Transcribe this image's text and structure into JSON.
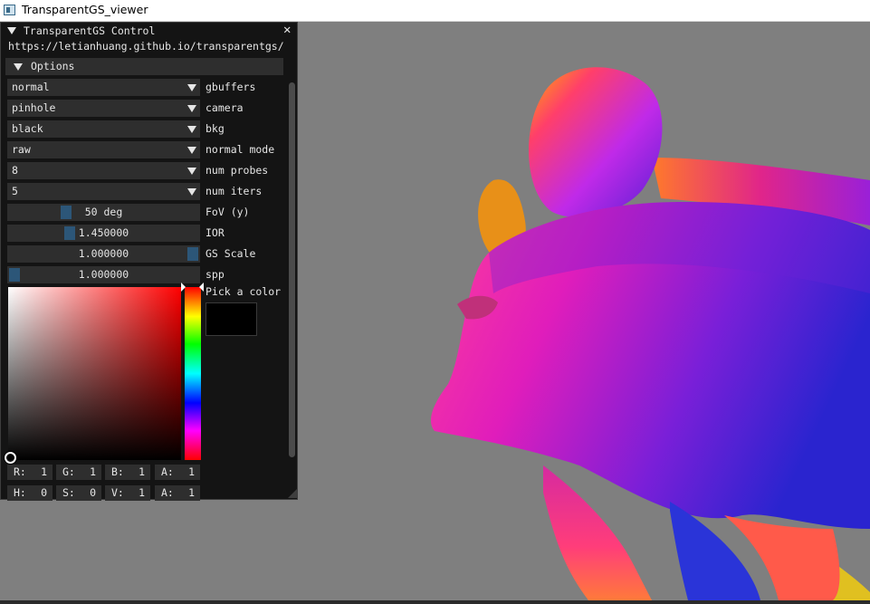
{
  "window": {
    "title": "TransparentGS_viewer"
  },
  "panel": {
    "title": "TransparentGS Control",
    "url": "https://letianhuang.github.io/transparentgs/",
    "section": "Options",
    "combos": [
      {
        "value": "normal",
        "label": "gbuffers"
      },
      {
        "value": "pinhole",
        "label": "camera"
      },
      {
        "value": "black",
        "label": "bkg"
      },
      {
        "value": "raw",
        "label": "normal mode"
      },
      {
        "value": "8",
        "label": "num probes"
      },
      {
        "value": "5",
        "label": "num iters"
      }
    ],
    "sliders": [
      {
        "text": "50 deg",
        "label": "FoV (y)",
        "level": 0.29
      },
      {
        "text": "1.450000",
        "label": "IOR",
        "level": 0.31
      },
      {
        "text": "1.000000",
        "label": "GS Scale",
        "level": 1.0
      },
      {
        "text": "1.000000",
        "label": "spp",
        "level": 0.0
      }
    ],
    "color_picker": {
      "label": "Pick a color",
      "color": "#000000",
      "rgba": [
        {
          "name": "R:",
          "value": "1"
        },
        {
          "name": "G:",
          "value": "1"
        },
        {
          "name": "B:",
          "value": "1"
        },
        {
          "name": "A:",
          "value": "1"
        }
      ],
      "hsva": [
        {
          "name": "H:",
          "value": "0"
        },
        {
          "name": "S:",
          "value": "0"
        },
        {
          "name": "V:",
          "value": "1"
        },
        {
          "name": "A:",
          "value": "1"
        }
      ]
    }
  },
  "colors": {
    "panel_bg": "#141414",
    "frame": "#2e2e2e",
    "grab": "#2c5678",
    "viewport": "#7f7f7f"
  }
}
